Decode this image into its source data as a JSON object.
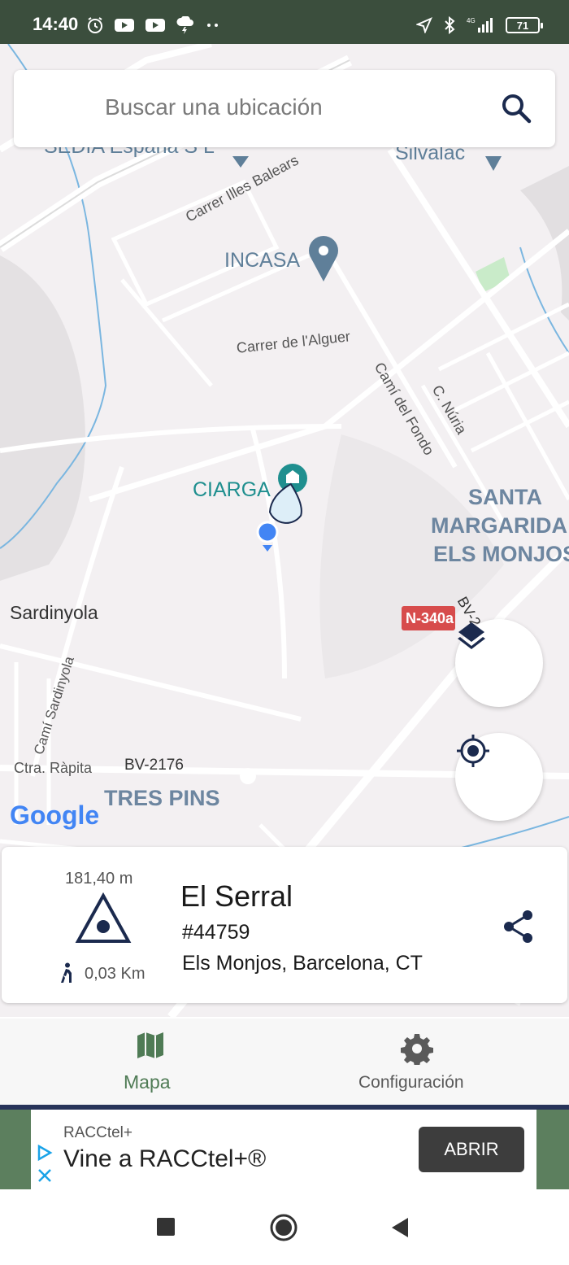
{
  "status_bar": {
    "time": "14:40",
    "battery": "71",
    "network": "4G",
    "left_icons": [
      "alarm-icon",
      "youtube-icon",
      "youtube-icon",
      "weather-storm-icon",
      "more-dots-icon"
    ],
    "right_icons": [
      "location-arrow-icon",
      "bluetooth-icon",
      "signal-icon",
      "battery-icon"
    ]
  },
  "search": {
    "placeholder": "Buscar una ubicación"
  },
  "map": {
    "labels": {
      "sedia": "SEDIA España S L",
      "silvalac": "Silvalac",
      "carrer_illes_balears": "Carrer Illes Balears",
      "incasa": "INCASA",
      "carrer_alguer": "Carrer de l'Alguer",
      "cami_del_fondo": "Camí del Fondo",
      "c_nuria": "C. Núria",
      "ciarga": "CIARGA",
      "santa_margarida": "SANTA",
      "santa_margarida_2": "MARGARIDA I",
      "santa_margarida_3": "ELS MONJOS",
      "sardinyola": "Sardinyola",
      "road_n340a": "N-340a",
      "road_bv2": "BV-2",
      "cami_sardinyola": "Camí Sardinyola",
      "ctra_rapita": "Ctra. Ràpita",
      "road_bv2176": "BV-2176",
      "tres_pins": "TRES PINS",
      "google": "Google"
    },
    "colors": {
      "background": "#f3f0f2",
      "road": "#ffffff",
      "water": "#7ab6e0",
      "poi_blue": "#5f7f99",
      "poi_teal": "#1f8f8f",
      "district": "#6d86a0",
      "road_badge": "#d74c4c"
    }
  },
  "info_card": {
    "elevation": "181,40 m",
    "walk_distance": "0,03 Km",
    "title": "El Serral",
    "number": "#44759",
    "region": "Els Monjos, Barcelona, CT"
  },
  "bottom_nav": {
    "items": [
      {
        "label": "Mapa",
        "icon": "map-icon",
        "active": true
      },
      {
        "label": "Configuración",
        "icon": "gear-icon",
        "active": false
      }
    ],
    "active_color": "#4f7b55"
  },
  "ad": {
    "advertiser": "RACCtel+",
    "headline": "Vine a RACCtel+®",
    "cta": "ABRIR"
  },
  "system_nav": {
    "buttons": [
      "recents-button",
      "home-button",
      "back-button"
    ]
  }
}
